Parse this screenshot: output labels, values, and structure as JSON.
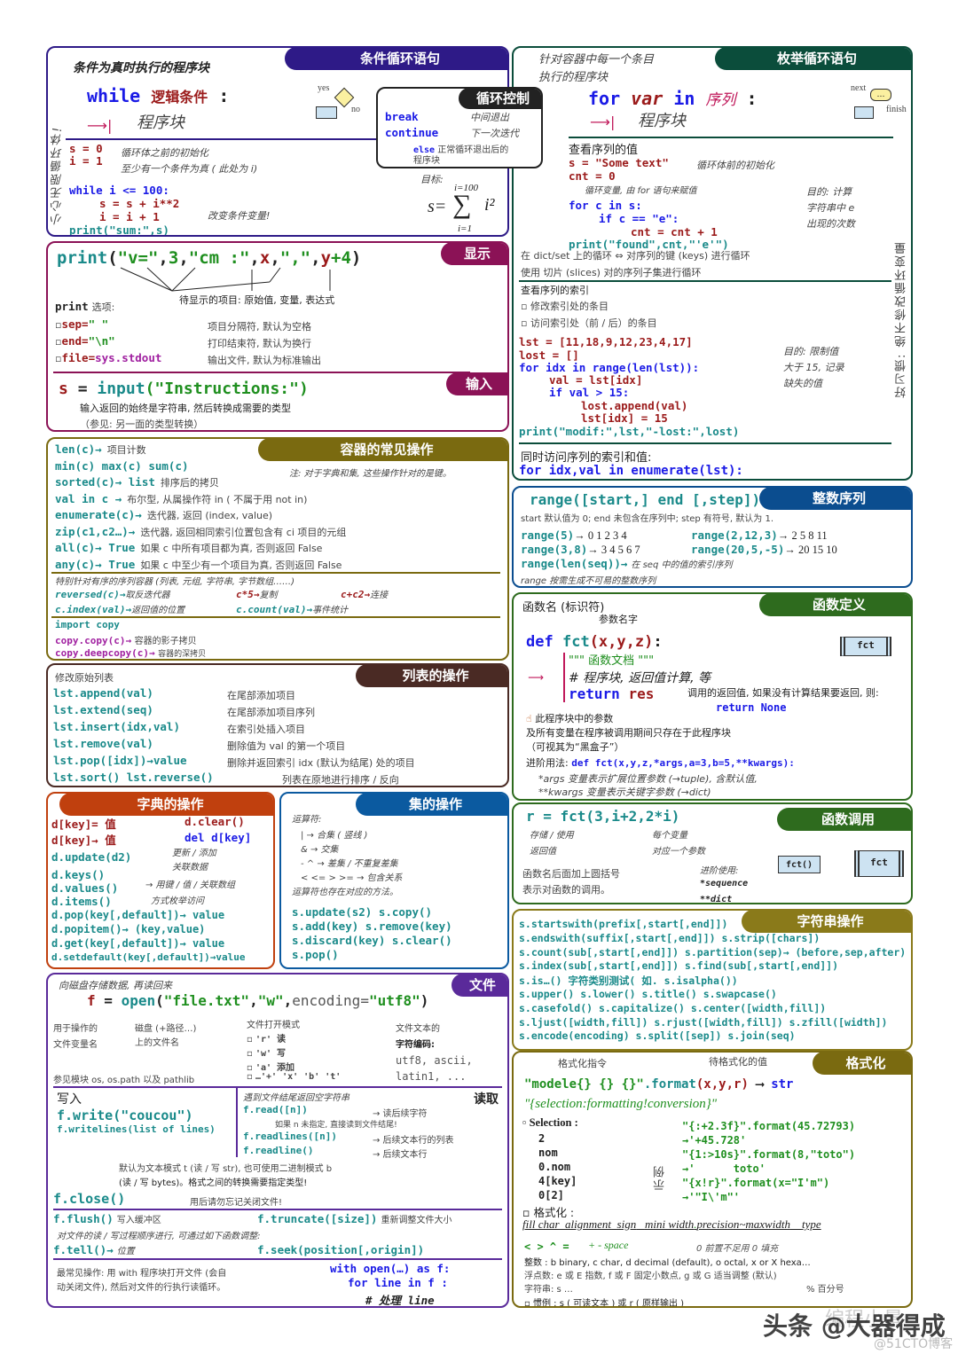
{
  "colors": {
    "loop_while": "#2e1a87",
    "loop_for": "#0b4d3b",
    "display": "#8b1256",
    "containers": "#7a6a10",
    "lists": "#4a2a24",
    "dicts": "#c0400e",
    "sets": "#0b5aa0",
    "files": "#5a2a9a",
    "range": "#0b4d8f",
    "functions": "#2e6b1e",
    "strings": "#8a7a1a",
    "format": "#7a6a10"
  },
  "while_section": {
    "header": "条件循环语句",
    "subtitle": "条件为真时执行的程序块",
    "vertical_note": "小心无限循环体!",
    "syntax_kw": "while",
    "syntax_cond": "逻辑条件",
    "syntax_colon": ":",
    "block": "程序块",
    "diagram": {
      "yes": "yes",
      "no": "no",
      "q": "?"
    },
    "init_s": "s = 0",
    "init_i": "i = 1",
    "init_note1": "循环体之前的初始化",
    "init_note2": "至少有一个条件为真 ( 此处为 i)",
    "code": [
      "while i <= 100:",
      "s = s + i**2",
      "i = i + 1",
      "print(\"sum:\",s)"
    ],
    "change_note": "改变条件变量!",
    "goal_label": "目标:",
    "formula": {
      "lhs": "s=",
      "sum": "∑",
      "upper": "i=100",
      "lower": "i=1",
      "term": "i²"
    }
  },
  "loop_control": {
    "header": "循环控制",
    "break_kw": "break",
    "break_desc": "中间退出",
    "continue_kw": "continue",
    "continue_desc": "下一次迭代",
    "else_kw": "else",
    "else_desc": "正常循环退出后的",
    "else_desc2": "程序块"
  },
  "for_section": {
    "header": "枚举循环语句",
    "subtitle1": "针对容器中每一个条目",
    "subtitle2": "执行的程序块",
    "syntax_for": "for",
    "syntax_var": "var",
    "syntax_in": "in",
    "syntax_seq": "序列",
    "syntax_colon": ":",
    "block": "程序块",
    "diagram": {
      "next": "next",
      "finish": "finish",
      "dots": "…"
    },
    "values_title": "查看序列的值",
    "code_s": "s = \"Some text\"",
    "code_cnt": "cnt = 0",
    "init_note": "循环体前的初始化",
    "loopvar_note": "循环变量, 由 for 语句来赋值",
    "code_for": "for c in s:",
    "code_if": "if c == \"e\":",
    "code_inc": "cnt = cnt + 1",
    "code_print": "print(\"found\",cnt,\"'e'\")",
    "goal1": "目的: 计算",
    "goal2": "字符串中 e",
    "goal3": "出现的次数",
    "dict_note": "在 dict/set 上的循环 ⇔ 对序列的键 (keys) 进行循环",
    "slice_note": "使用 切片 (slices) 对的序列子集进行循环",
    "index_title": "查看序列的索引",
    "opt1": "修改索引处的条目",
    "opt2": "访问索引处（前 / 后）的条目",
    "code2": [
      "lst = [11,18,9,12,23,4,17]",
      "lost = []",
      "for idx in range(len(lst)):",
      "val = lst[idx]",
      "if val > 15:",
      "lost.append(val)",
      "lst[idx] = 15",
      "print(\"modif:\",lst,\"-lost:\",lost)"
    ],
    "goal2_1": "目的: 限制值",
    "goal2_2": "大于 15, 记录",
    "goal2_3": "缺失的值",
    "enum_title": "同时访问序列的索引和值:",
    "enum_code": "for idx,val in enumerate(lst):",
    "vertical_note": "好习惯: 绝不修改循环变量"
  },
  "display": {
    "header": "显示",
    "print_fn": "print",
    "print_args": [
      "(",
      "\"v=\"",
      ",",
      "3",
      ",",
      "\"cm :\"",
      ",",
      "x",
      ",",
      "\",\"",
      ",",
      "y",
      "+4",
      ")"
    ],
    "items_note": "待显示的项目: 原始值, 变量, 表达式",
    "options_title_kw": "print",
    "options_title": "选项:",
    "options": [
      {
        "name": "sep=",
        "value": "\" \"",
        "desc": "项目分隔符, 默认为空格"
      },
      {
        "name": "end=",
        "value": "\"\\n\"",
        "desc": "打印结束符, 默认为换行"
      },
      {
        "name": "file=",
        "value": "sys.stdout",
        "desc": "输出文件, 默认为标准输出"
      }
    ]
  },
  "input": {
    "header": "输入",
    "code_var": "s",
    "code_eq": "=",
    "code_fn": "input",
    "code_arg": "(\"Instructions:\")",
    "note1": "输入返回的始终是字符串, 然后转换成需要的类型",
    "note2": "（参见: 另一面的类型转换）"
  },
  "containers": {
    "header": "容器的常见操作",
    "note": "注: 对于字典和集, 这些操作针对的是键。",
    "lines": [
      {
        "code": "len(c)→",
        "desc": "项目计数"
      },
      {
        "code": "min(c)   max(c)   sum(c)",
        "desc": ""
      },
      {
        "code": "sorted(c)→ list",
        "desc": "排序后的拷贝"
      },
      {
        "code": "val in c →",
        "desc": "布尔型, 从属操作符 in ( 不属于用 not in)"
      },
      {
        "code": "enumerate(c)→",
        "desc": "迭代器, 返回 (index, value)"
      },
      {
        "code": "zip(c1,c2…)→",
        "desc": "迭代器, 返回相同索引位置包含有 ci 项目的元组"
      },
      {
        "code": "all(c)→ True",
        "desc": "如果 c 中所有项目都为真, 否则返回 False"
      },
      {
        "code": "any(c)→ True",
        "desc": "如果 c 中至少有一个项目为真, 否则返回 False"
      }
    ],
    "ordered_note": "特别针对有序的序列容器 (列表, 元组, 字符串, 字节数组……)",
    "ordered": [
      {
        "code": "reversed(c)→",
        "desc": "取反迭代器"
      },
      {
        "code": "c*5→",
        "desc": "复制"
      },
      {
        "code": "c+c2→",
        "desc": "连接"
      },
      {
        "code": "c.index(val)→",
        "desc": "返回值的位置"
      },
      {
        "code": "c.count(val)→",
        "desc": "事件统计"
      }
    ],
    "copy_import": "import copy",
    "copy1_code": "copy.copy(c)→",
    "copy1_desc": "容器的影子拷贝",
    "copy2_code": "copy.deepcopy(c)→",
    "copy2_desc": "容器的深拷贝"
  },
  "range": {
    "header": "整数序列",
    "syntax": "range([start,] end [,step])",
    "note": "start 默认值为 0; end 未包含在序列中; step 有符号, 默认为 1.",
    "examples": [
      {
        "code": "range(5)",
        "result": "→ 0 1 2 3 4"
      },
      {
        "code": "range(2,12,3)",
        "result": "→ 2 5 8 11"
      },
      {
        "code": "range(3,8)",
        "result": "→ 3 4 5 6 7"
      },
      {
        "code": "range(20,5,-5)",
        "result": "→ 20 15 10"
      }
    ],
    "len_code": "range(len(seq))→",
    "len_desc": "在 seq 中的值的索引序列",
    "lazy_note": "range 按需生成不可易的整数序列"
  },
  "lists": {
    "header": "列表的操作",
    "note": "修改原始列表",
    "items": [
      {
        "code": "lst.append(val)",
        "desc": "在尾部添加项目"
      },
      {
        "code": "lst.extend(seq)",
        "desc": "在尾部添加项目序列"
      },
      {
        "code": "lst.insert(idx,val)",
        "desc": "在索引处插入项目"
      },
      {
        "code": "lst.remove(val)",
        "desc": "删除值为 val 的第一个项目"
      },
      {
        "code": "lst.pop([idx])→value",
        "desc": "删除并返回索引 idx (默认为结尾) 处的项目"
      },
      {
        "code": "lst.sort()  lst.reverse()",
        "desc": "列表在原地进行排序 / 反向"
      }
    ]
  },
  "functions": {
    "header": "函数定义",
    "name_label": "函数名 (标识符)",
    "params_label": "参数名字",
    "def_kw": "def",
    "fct": "fct",
    "params": "(x,y,z)",
    "colon": ":",
    "docstring": "\"\"\" 函数文档 \"\"\"",
    "comment": "# 程序块, 返回值计算, 等",
    "return_kw": "return",
    "return_var": "res",
    "return_note": "调用的返回值, 如果没有计算结果要返回, 则:",
    "return_none": "return None",
    "box_label": "fct",
    "scope_note1": "此程序块中的参数",
    "scope_note2": "及所有变量在程序被调用期间只存在于此程序块",
    "scope_note3": "（可视其为“黑盒子”）",
    "adv_label": "进阶用法:",
    "adv_code": "def fct(x,y,z,*args,a=3,b=5,**kwargs):",
    "args_line": "*args 变量表示扩展位置参数 (→tuple), 含默认值,",
    "kwargs_line": "**kwargs 变量表示关键字参数 (→dict)"
  },
  "calls": {
    "header": "函数调用",
    "code": "r = fct(3,i+2,2*i)",
    "store1": "存储 / 使用",
    "store2": "返回值",
    "each1": "每个变量",
    "each2": "对应一个参数",
    "note1": "函数名后面加上圆括号",
    "note2": "表示对函数的调用。",
    "adv_label": "进阶使用:",
    "adv1": "*sequence",
    "adv2": "**dict",
    "box_call": "fct()",
    "box_def": "fct"
  },
  "dicts": {
    "header": "字典的操作",
    "items": [
      "d[key]= 值",
      "d.clear()",
      "d[key]→ 值",
      "del d[key]",
      "d.update(d2)",
      "d.keys()",
      "d.values()",
      "d.items()",
      "d.pop(key[,default])→ value",
      "d.popitem()→ (key,value)",
      "d.get(key[,default])→ value",
      "d.setdefault(key[,default])→value"
    ],
    "update_note1": "更新 / 添加",
    "update_note2": "关联数据",
    "view_note1": "→ 用键 / 值 / 关联数组",
    "view_note2": "方式枚举访问"
  },
  "sets": {
    "header": "集的操作",
    "ops_title": "运算符:",
    "ops": [
      "| → 合集 ( 竖线 )",
      "& → 交集",
      "- ^ → 差集 / 不重复差集",
      "< <= > >= → 包含关系"
    ],
    "ops_note": "运算符也存在对应的方法。",
    "methods": [
      "s.update(s2)  s.copy()",
      "s.add(key)  s.remove(key)",
      "s.discard(key)  s.clear()",
      "s.pop()"
    ]
  },
  "files": {
    "header": "文件",
    "subtitle": "向磁盘存储数据, 再读回来",
    "open_var": "f",
    "open_eq": "=",
    "open_fn": "open",
    "open_arg1": "\"file.txt\"",
    "open_arg2": "\"w\"",
    "open_kw": "encoding=",
    "open_arg3": "\"utf8\"",
    "var_note1": "用于操作的",
    "var_note2": "文件变量名",
    "name_note1": "磁盘 (+路径…)",
    "name_note2": "上的文件名",
    "mode_title": "文件打开模式",
    "modes": [
      "'r' 读",
      "'w' 写",
      "'a' 添加",
      "…'+' 'x' 'b' 't'"
    ],
    "enc_note1": "文件文本的",
    "enc_note2": "字符编码:",
    "enc_list1": "utf8, ascii,",
    "enc_list2": "latin1, ...",
    "modules_note": "参见模块 os, os.path 以及 pathlib",
    "write_title": "写入",
    "write_code": "f.write(\"coucou\")",
    "writelines_code": "f.writelines(list of lines)",
    "read_title": "读取",
    "eof_note": "遇到文件结尾返回空字符串",
    "read_items": [
      {
        "code": "f.read([n])",
        "desc": "→ 读后续字符"
      },
      {
        "code": "f.readlines([n])",
        "desc": "→ 后续文本行的列表"
      },
      {
        "code": "f.readline()",
        "desc": "→ 后续文本行"
      }
    ],
    "read_note": "如果 n 未指定, 直接读到文件结尾!",
    "mode_note1": "默认为文本模式 t (读 / 写 str), 也可使用二进制模式 b",
    "mode_note2": "(读 / 写 bytes)。格式之间的转换需要指定类型!",
    "close_code": "f.close()",
    "close_note": "用后请勿忘记关闭文件!",
    "flush_code": "f.flush()",
    "flush_desc": "写入缓冲区",
    "truncate_code": "f.truncate([size])",
    "truncate_desc": "重新调整文件大小",
    "seq_note": "对文件的读 / 写过程顺序进行, 可通过如下函数调整:",
    "tell_code": "f.tell()→",
    "tell_desc": "位置",
    "seek_code": "f.seek(position[,origin])",
    "with_note1": "最常见操作: 用 with 程序块打开文件 (会自",
    "with_note2": "动关闭文件), 然后对文件的行执行读循环。",
    "with_code1": "with open(…) as f:",
    "with_code2": "for line in f :",
    "with_code3": "# 处理 line"
  },
  "strings": {
    "header": "字符串操作",
    "lines": [
      "s.startswith(prefix[,start[,end]])",
      "s.endswith(suffix[,start[,end]])  s.strip([chars])",
      "s.count(sub[,start[,end]])  s.partition(sep)→ (before,sep,after)",
      "s.index(sub[,start[,end]])  s.find(sub[,start[,end]])",
      "s.is…() 字符类别测试( 如. s.isalpha())",
      "s.upper()   s.lower()   s.title()   s.swapcase()",
      "s.casefold()   s.capitalize()   s.center([width,fill])",
      "s.ljust([width,fill])  s.rjust([width,fill])  s.zfill([width])",
      "s.encode(encoding)   s.split([sep])   s.join(seq)"
    ]
  },
  "format": {
    "header": "格式化",
    "directive_label": "格式化指令",
    "values_label": "待格式化的值",
    "template": "\"modele{} {} {}\"",
    "format_fn": ".format",
    "format_args": "(x,y,r)",
    "result": "str",
    "spec": "\"{selection:formatting!conversion}\"",
    "selection_title": "Selection :",
    "selection_items": [
      "2",
      "nom",
      "0.nom",
      "4[key]",
      "0[2]"
    ],
    "examples_label": "示例",
    "examples": [
      "\"{:+2.3f}\".format(45.72793)",
      "→'+45.728'",
      "\"{1:>10s}\".format(8,\"toto\")",
      "→'      toto'",
      "\"{x!r}\".format(x=\"I'm\")",
      "→'\"I\\'m\"'"
    ],
    "formatting_title": "格式化 :",
    "spec_parts": [
      "fill char",
      "alignment",
      "sign",
      "mini width",
      ".",
      "precision~maxwidth",
      "type"
    ],
    "align_chars": "< > ^ =",
    "sign_chars": "+ - space",
    "zero_note": "0 前置不足用 0 填充",
    "int_line": "整数 : b binary, c char, d decimal (default), o octal, x or X hexa…",
    "float_line": "浮点数: e 或 E 指数, f 或 F 固定小数点, g 或 G 适当调整 (默认)",
    "str_line": "字符串: s …",
    "percent_line": "% 百分号",
    "conv_line": "惯例 : s ( 可读文本 )  或 r ( 原样输出 )"
  },
  "watermark": {
    "main": "头条 @大器得成",
    "faded": "编程小景",
    "site": "@51CTO博客"
  }
}
